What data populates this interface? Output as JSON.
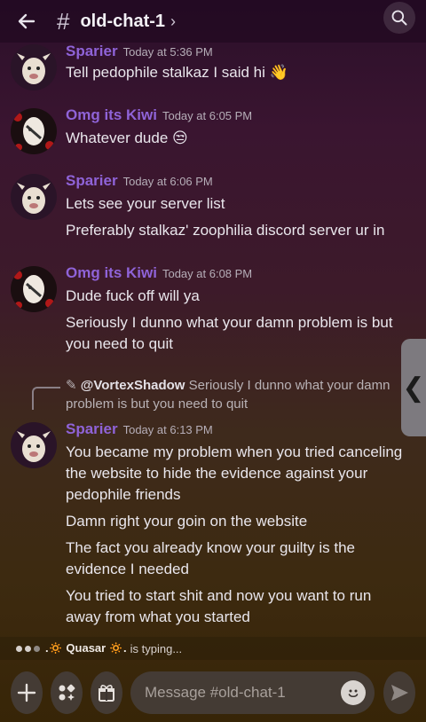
{
  "header": {
    "hash": "#",
    "channel": "old-chat-1",
    "chevron": "›",
    "back_icon": "arrow-left-icon",
    "search_icon": "search-icon"
  },
  "messages": [
    {
      "author": "Sparier",
      "timestamp": "Today at 5:36 PM",
      "lines": [
        "Tell pedophile stalkaz I said hi 👋"
      ]
    },
    {
      "author": "Omg its Kiwi",
      "timestamp": "Today at 6:05 PM",
      "lines": [
        "Whatever dude 😒"
      ]
    },
    {
      "author": "Sparier",
      "timestamp": "Today at 6:06 PM",
      "lines": [
        "Lets see your server list",
        "Preferably stalkaz' zoophilia discord server ur in"
      ]
    },
    {
      "author": "Omg its Kiwi",
      "timestamp": "Today at 6:08 PM",
      "lines": [
        "Dude fuck off will ya",
        "Seriously I dunno what your damn problem is but you need to quit"
      ]
    },
    {
      "reply": {
        "name": "@VortexShadow",
        "text": "Seriously I dunno what your damn problem is but you need to quit"
      },
      "author": "Sparier",
      "timestamp": "Today at 6:13 PM",
      "lines": [
        "You became my problem when you tried canceling the website to hide the evidence against your pedophile friends",
        "Damn right your goin on the website",
        "The fact you already know your guilty is the evidence I needed",
        "You tried to start shit and now you want to run away from what you started"
      ]
    }
  ],
  "typing": {
    "name": ".🔅 Quasar 🔅.",
    "text": "is typing..."
  },
  "composer": {
    "placeholder": "Message #old-chat-1",
    "plus_icon": "plus-icon",
    "apps_icon": "apps-icon",
    "gift_icon": "gift-icon",
    "emoji_icon": "emoji-icon",
    "send_icon": "send-icon"
  },
  "side_handle": "❮",
  "colors": {
    "author": "#8f63d8",
    "accent_bg": "#3d1a2a"
  }
}
